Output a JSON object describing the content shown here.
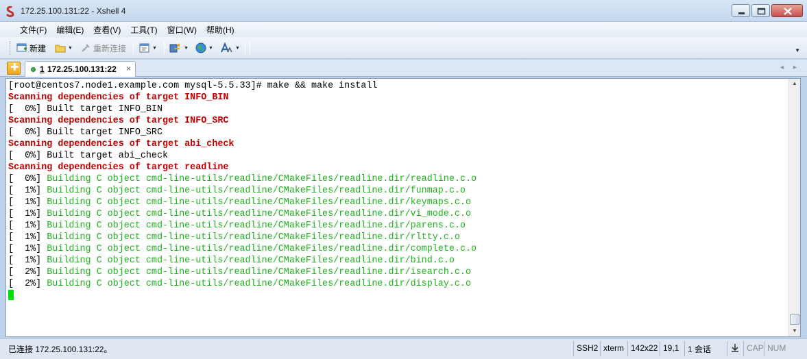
{
  "window": {
    "title": "172.25.100.131:22 - Xshell 4"
  },
  "menu": [
    "文件(F)",
    "编辑(E)",
    "查看(V)",
    "工具(T)",
    "窗口(W)",
    "帮助(H)"
  ],
  "toolbar": {
    "new_label": "新建",
    "reconnect_label": "重新连接"
  },
  "tab": {
    "number": "1",
    "label": "172.25.100.131:22",
    "close": "×"
  },
  "terminal": {
    "lines": [
      {
        "text": "[root@centos7.node1.example.com mysql-5.5.33]# make && make install",
        "color": "default"
      },
      {
        "text": "Scanning dependencies of target INFO_BIN",
        "color": "red"
      },
      {
        "text": "[  0%] Built target INFO_BIN",
        "color": "default"
      },
      {
        "text": "Scanning dependencies of target INFO_SRC",
        "color": "red"
      },
      {
        "text": "[  0%] Built target INFO_SRC",
        "color": "default"
      },
      {
        "text": "Scanning dependencies of target abi_check",
        "color": "red"
      },
      {
        "text": "[  0%] Built target abi_check",
        "color": "default"
      },
      {
        "text": "Scanning dependencies of target readline",
        "color": "red"
      },
      {
        "prefix": "[  0%] ",
        "text": "Building C object cmd-line-utils/readline/CMakeFiles/readline.dir/readline.c.o",
        "color": "green"
      },
      {
        "prefix": "[  1%] ",
        "text": "Building C object cmd-line-utils/readline/CMakeFiles/readline.dir/funmap.c.o",
        "color": "green"
      },
      {
        "prefix": "[  1%] ",
        "text": "Building C object cmd-line-utils/readline/CMakeFiles/readline.dir/keymaps.c.o",
        "color": "green"
      },
      {
        "prefix": "[  1%] ",
        "text": "Building C object cmd-line-utils/readline/CMakeFiles/readline.dir/vi_mode.c.o",
        "color": "green"
      },
      {
        "prefix": "[  1%] ",
        "text": "Building C object cmd-line-utils/readline/CMakeFiles/readline.dir/parens.c.o",
        "color": "green"
      },
      {
        "prefix": "[  1%] ",
        "text": "Building C object cmd-line-utils/readline/CMakeFiles/readline.dir/rltty.c.o",
        "color": "green"
      },
      {
        "prefix": "[  1%] ",
        "text": "Building C object cmd-line-utils/readline/CMakeFiles/readline.dir/complete.c.o",
        "color": "green"
      },
      {
        "prefix": "[  1%] ",
        "text": "Building C object cmd-line-utils/readline/CMakeFiles/readline.dir/bind.c.o",
        "color": "green"
      },
      {
        "prefix": "[  2%] ",
        "text": "Building C object cmd-line-utils/readline/CMakeFiles/readline.dir/isearch.c.o",
        "color": "green"
      },
      {
        "prefix": "[  2%] ",
        "text": "Building C object cmd-line-utils/readline/CMakeFiles/readline.dir/display.c.o",
        "color": "green"
      }
    ]
  },
  "statusbar": {
    "connection": "已连接 172.25.100.131:22。",
    "protocol": "SSH2",
    "term_type": "xterm",
    "size": "142x22",
    "cursor_pos": "19,1",
    "sessions": "1 会话",
    "cap": "CAP",
    "num": "NUM"
  },
  "colors": {
    "red_text": "#c00000",
    "green_text": "#20b020",
    "cursor": "#00e000",
    "chrome": "#dce7f3"
  }
}
